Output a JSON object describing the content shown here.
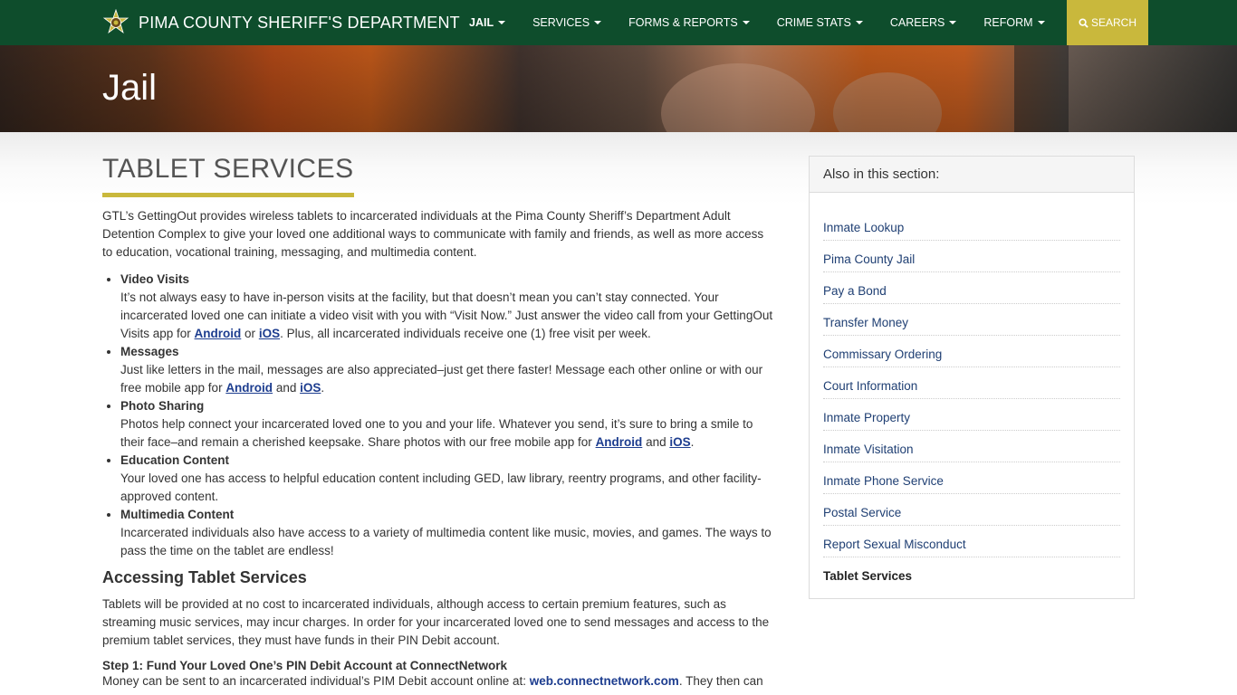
{
  "navbar": {
    "brand": "PIMA COUNTY SHERIFF'S DEPARTMENT",
    "items": [
      {
        "label": "JAIL"
      },
      {
        "label": "SERVICES"
      },
      {
        "label": "FORMS & REPORTS"
      },
      {
        "label": "CRIME STATS"
      },
      {
        "label": "CAREERS"
      },
      {
        "label": "REFORM"
      }
    ],
    "search_label": "SEARCH"
  },
  "hero": {
    "title": "Jail"
  },
  "main": {
    "title": "TABLET SERVICES",
    "intro": "GTL’s GettingOut provides wireless tablets to incarcerated individuals at the Pima County Sheriff’s Department Adult Detention Complex to give your loved one additional ways to communicate with family and friends, as well as more access to education, vocational training, messaging, and multimedia content.",
    "features": [
      {
        "title": "Video Visits",
        "text_before": "It’s not always easy to have in-person visits at the facility, but that doesn’t mean you can’t stay connected.  Your incarcerated loved one can initiate a video visit with you with “Visit Now.” Just answer the video call from your GettingOut Visits app for ",
        "link1": "Android",
        "between": " or ",
        "link2": "iOS",
        "text_after": ". Plus, all incarcerated individuals receive one (1) free visit per week."
      },
      {
        "title": "Messages",
        "text_before": "Just like letters in the mail, messages are also appreciated–just get there faster!  Message each other online or with our free mobile app for ",
        "link1": "Android",
        "between": " and ",
        "link2": "iOS",
        "text_after": "."
      },
      {
        "title": "Photo Sharing",
        "text_before": "Photos help connect your incarcerated loved one to you and your life. Whatever you send, it’s sure to bring a smile to their face–and remain a cherished keepsake.  Share photos with our free mobile app for ",
        "link1": "Android",
        "between": " and ",
        "link2": "iOS",
        "text_after": "."
      },
      {
        "title": "Education Content",
        "text": "Your loved one has access to helpful education content including GED, law library, reentry programs, and other facility-approved content."
      },
      {
        "title": "Multimedia Content",
        "text": "Incarcerated individuals also have access to a variety of multimedia content like music, movies, and games. The ways to pass the time on the tablet are endless!"
      }
    ],
    "accessing_heading": "Accessing Tablet Services",
    "accessing_text": "Tablets will be provided at no cost to incarcerated individuals, although access to certain premium features, such as streaming music services, may incur charges.  In order for your incarcerated loved one to send messages and access to the premium tablet services, they must have funds in their PIN Debit account.",
    "step1_heading": "Step 1: Fund Your Loved One’s PIN Debit Account at ConnectNetwork",
    "step1_before": "Money can be sent to an incarcerated individual’s PIM Debit account online at: ",
    "step1_link": "web.connectnetwork.com",
    "step1_after": ". They then can"
  },
  "sidebar": {
    "heading": "Also in this section:",
    "items": [
      {
        "label": "Inmate Lookup"
      },
      {
        "label": "Pima County Jail"
      },
      {
        "label": "Pay a Bond"
      },
      {
        "label": "Transfer Money"
      },
      {
        "label": "Commissary Ordering"
      },
      {
        "label": "Court Information"
      },
      {
        "label": "Inmate Property"
      },
      {
        "label": "Inmate Visitation"
      },
      {
        "label": "Inmate Phone Service"
      },
      {
        "label": "Postal Service"
      },
      {
        "label": "Report Sexual Misconduct"
      },
      {
        "label": "Tablet Services"
      }
    ],
    "current": "Tablet Services"
  },
  "colors": {
    "navbar": "#0e4d2c",
    "accent_gold": "#c9b83c",
    "link": "#1d3d8f"
  },
  "icons": {
    "brand": "sheriff-star-badge-icon",
    "search": "search-icon",
    "dropdown": "caret-down-icon"
  }
}
